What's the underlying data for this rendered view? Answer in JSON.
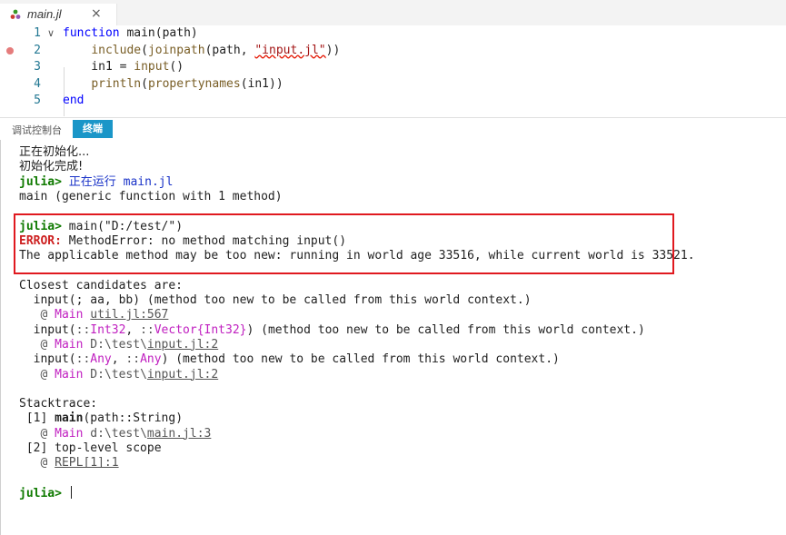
{
  "editor": {
    "tab": {
      "filename": "main.jl",
      "close": "×"
    },
    "lines": [
      {
        "num": "1",
        "tokens": [
          {
            "t": "kw",
            "v": "function"
          },
          {
            "t": "plain",
            "v": " main(path)"
          }
        ]
      },
      {
        "num": "2",
        "tokens": [
          {
            "t": "plain",
            "v": "    "
          },
          {
            "t": "fn",
            "v": "include"
          },
          {
            "t": "plain",
            "v": "("
          },
          {
            "t": "fn",
            "v": "joinpath"
          },
          {
            "t": "plain",
            "v": "(path, "
          },
          {
            "t": "strsq",
            "v": "\"input.jl\""
          },
          {
            "t": "plain",
            "v": "))"
          }
        ]
      },
      {
        "num": "3",
        "tokens": [
          {
            "t": "plain",
            "v": "    in1 = "
          },
          {
            "t": "fn",
            "v": "input"
          },
          {
            "t": "plain",
            "v": "()"
          }
        ]
      },
      {
        "num": "4",
        "tokens": [
          {
            "t": "plain",
            "v": "    "
          },
          {
            "t": "fn",
            "v": "println"
          },
          {
            "t": "plain",
            "v": "("
          },
          {
            "t": "fn",
            "v": "propertynames"
          },
          {
            "t": "plain",
            "v": "(in1))"
          }
        ]
      },
      {
        "num": "5",
        "tokens": [
          {
            "t": "kw",
            "v": "end"
          }
        ]
      }
    ]
  },
  "panel": {
    "tabs": {
      "debug_console": "调试控制台",
      "terminal": "终端"
    }
  },
  "terminal": {
    "lines": [
      [
        {
          "c": "cjk",
          "v": "正在初始化..."
        }
      ],
      [
        {
          "c": "cjk",
          "v": "初始化完成!"
        }
      ],
      [
        {
          "c": "prompt",
          "v": "julia> "
        },
        {
          "c": "blue cjk",
          "v": "正在运行"
        },
        {
          "c": "blue",
          "v": " main.jl"
        }
      ],
      [
        {
          "c": "",
          "v": "main (generic function with 1 method)"
        }
      ],
      [
        {
          "c": "",
          "v": ""
        }
      ],
      [
        {
          "c": "prompt",
          "v": "julia> "
        },
        {
          "c": "",
          "v": "main(\"D:/test/\")"
        }
      ],
      [
        {
          "c": "err",
          "v": "ERROR: "
        },
        {
          "c": "",
          "v": "MethodError: no method matching input()"
        }
      ],
      [
        {
          "c": "",
          "v": "The applicable method may be too new: running in world age 33516, while current world is 33521."
        }
      ],
      [
        {
          "c": "",
          "v": ""
        }
      ],
      [
        {
          "c": "",
          "v": "Closest candidates are:"
        }
      ],
      [
        {
          "c": "",
          "v": "  input(; aa, bb) (method too new to be called from this world context.)"
        }
      ],
      [
        {
          "c": "gray",
          "v": "   @ "
        },
        {
          "c": "mag",
          "v": "Main"
        },
        {
          "c": "gray",
          "v": " "
        },
        {
          "c": "ul",
          "v": "util.jl:567"
        }
      ],
      [
        {
          "c": "",
          "v": "  input("
        },
        {
          "c": "gray",
          "v": "::"
        },
        {
          "c": "mag",
          "v": "Int32"
        },
        {
          "c": "",
          "v": ", "
        },
        {
          "c": "gray",
          "v": "::"
        },
        {
          "c": "mag",
          "v": "Vector{Int32}"
        },
        {
          "c": "",
          "v": ") (method too new to be called from this world context.)"
        }
      ],
      [
        {
          "c": "gray",
          "v": "   @ "
        },
        {
          "c": "mag",
          "v": "Main"
        },
        {
          "c": "gray",
          "v": " D:\\test\\"
        },
        {
          "c": "ul",
          "v": "input.jl:2"
        }
      ],
      [
        {
          "c": "",
          "v": "  input("
        },
        {
          "c": "gray",
          "v": "::"
        },
        {
          "c": "mag",
          "v": "Any"
        },
        {
          "c": "",
          "v": ", "
        },
        {
          "c": "gray",
          "v": "::"
        },
        {
          "c": "mag",
          "v": "Any"
        },
        {
          "c": "",
          "v": ") (method too new to be called from this world context.)"
        }
      ],
      [
        {
          "c": "gray",
          "v": "   @ "
        },
        {
          "c": "mag",
          "v": "Main"
        },
        {
          "c": "gray",
          "v": " D:\\test\\"
        },
        {
          "c": "ul",
          "v": "input.jl:2"
        }
      ],
      [
        {
          "c": "",
          "v": ""
        }
      ],
      [
        {
          "c": "",
          "v": "Stacktrace:"
        }
      ],
      [
        {
          "c": "",
          "v": " [1] "
        },
        {
          "c": "bold",
          "v": "main"
        },
        {
          "c": "",
          "v": "(path::String)"
        }
      ],
      [
        {
          "c": "gray",
          "v": "   @ "
        },
        {
          "c": "mag",
          "v": "Main"
        },
        {
          "c": "gray",
          "v": " d:\\test\\"
        },
        {
          "c": "ul",
          "v": "main.jl:3"
        }
      ],
      [
        {
          "c": "",
          "v": " [2] top-level scope"
        }
      ],
      [
        {
          "c": "gray",
          "v": "   @ "
        },
        {
          "c": "ul",
          "v": "REPL[1]:1"
        }
      ],
      [
        {
          "c": "",
          "v": ""
        }
      ],
      [
        {
          "c": "prompt",
          "v": "julia> "
        }
      ]
    ]
  },
  "colors": {
    "error_box": "#e0191f",
    "active_tab": "#1a96c8",
    "prompt": "#0f7a00",
    "breakpoint": "#e57c7c"
  }
}
